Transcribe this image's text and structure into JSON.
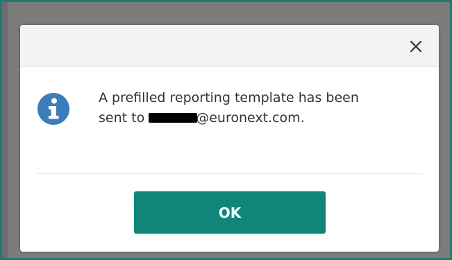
{
  "dialog": {
    "close_glyph": "×",
    "icon": "info-icon",
    "message_line1": "A prefilled reporting template has been",
    "message_line2_prefix": "sent to ",
    "message_line2_suffix": "@euronext.com.",
    "ok_label": "OK"
  },
  "colors": {
    "accent": "#10857a",
    "info_icon": "#3b7dbb",
    "backdrop": "#7c7c7c"
  }
}
